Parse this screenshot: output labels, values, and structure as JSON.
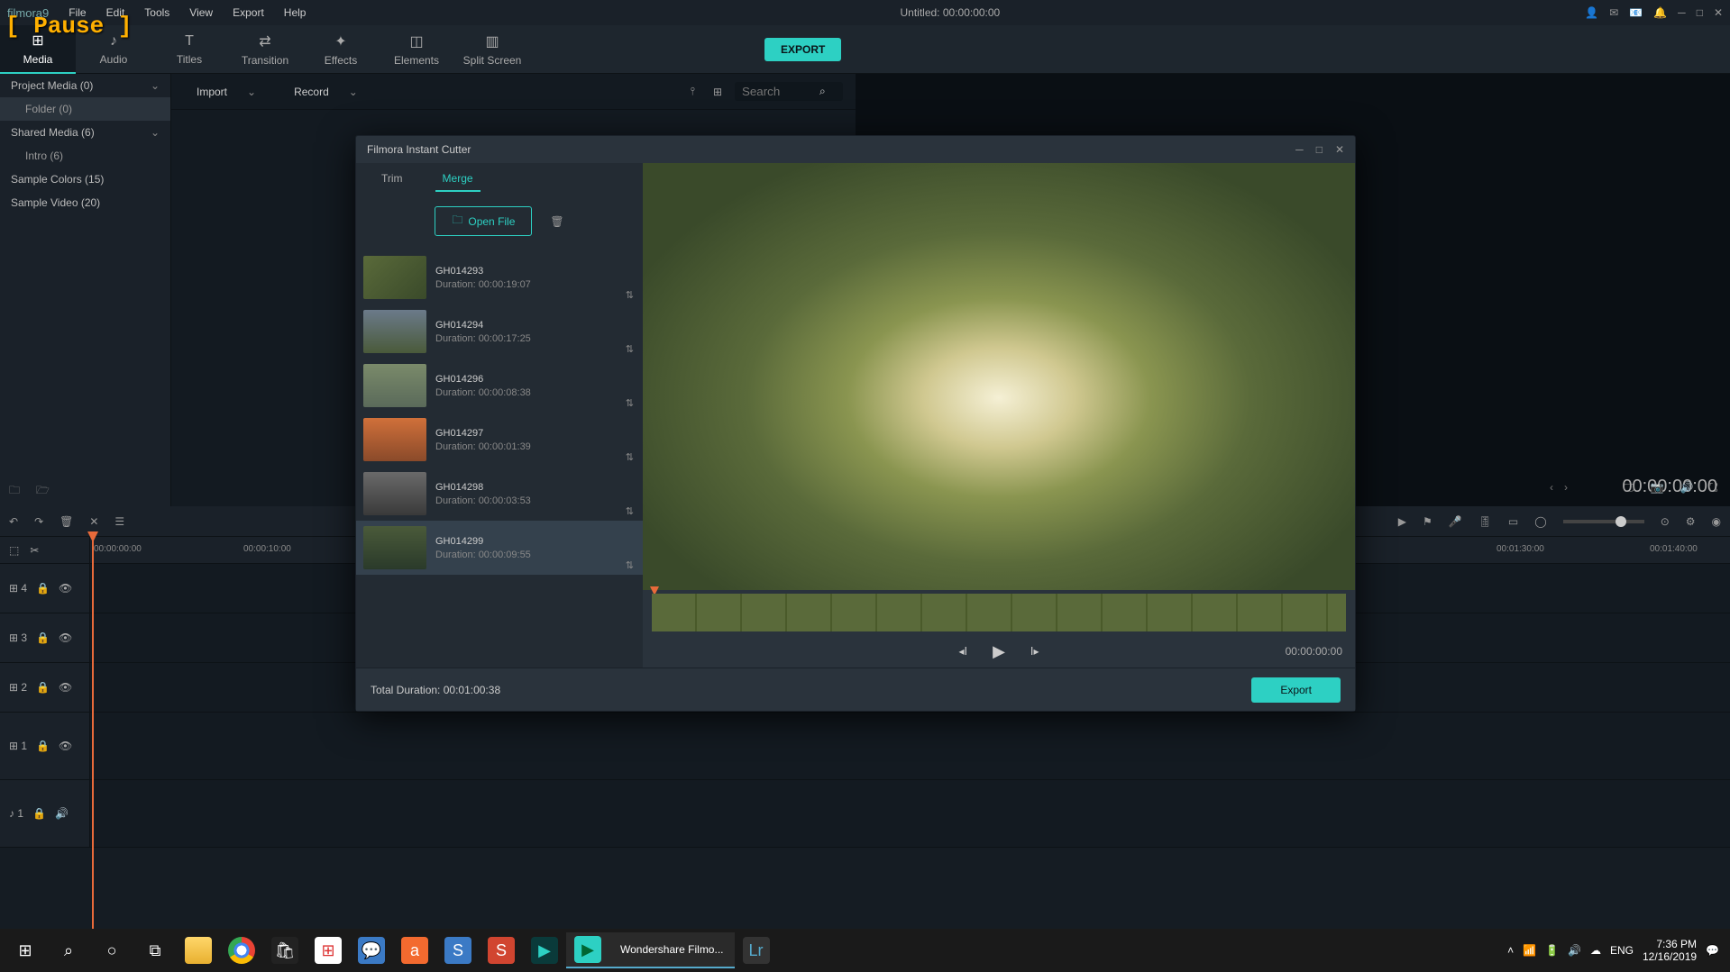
{
  "titlebar": {
    "logo": "filmora9",
    "menus": [
      "File",
      "Edit",
      "Tools",
      "View",
      "Export",
      "Help"
    ],
    "title": "Untitled:  00:00:00:00"
  },
  "pause_overlay": "[ Pause ]",
  "toolbar_tabs": [
    {
      "label": "Media",
      "icon": "⊞"
    },
    {
      "label": "Audio",
      "icon": "♪"
    },
    {
      "label": "Titles",
      "icon": "T"
    },
    {
      "label": "Transition",
      "icon": "⇄"
    },
    {
      "label": "Effects",
      "icon": "✦"
    },
    {
      "label": "Elements",
      "icon": "◫"
    },
    {
      "label": "Split Screen",
      "icon": "▥"
    }
  ],
  "export_label": "EXPORT",
  "sidebar": {
    "items": [
      {
        "label": "Project Media (0)",
        "expand": true
      },
      {
        "label": "Folder (0)",
        "sub": true,
        "hl": true
      },
      {
        "label": "Shared Media (6)",
        "expand": true
      },
      {
        "label": "Intro (6)",
        "sub": true
      },
      {
        "label": "Sample Colors (15)"
      },
      {
        "label": "Sample Video (20)"
      }
    ]
  },
  "media_bar": {
    "import": "Import",
    "record": "Record",
    "search_ph": "Search"
  },
  "preview": {
    "time": "00:00:00:00"
  },
  "timeline": {
    "ruler": [
      "00:00:00:00",
      "00:00:10:00",
      "00:01:30:00",
      "00:01:40:00"
    ],
    "ruler_pos": [
      0,
      170,
      1560,
      1730
    ],
    "tracks": [
      {
        "label": "⊞ 4"
      },
      {
        "label": "⊞ 3"
      },
      {
        "label": "⊞ 2"
      },
      {
        "label": "⊞ 1"
      },
      {
        "label": "♪ 1",
        "audio": true
      }
    ]
  },
  "modal": {
    "title": "Filmora Instant Cutter",
    "tabs": {
      "trim": "Trim",
      "merge": "Merge"
    },
    "open_file": "Open File",
    "clips": [
      {
        "name": "GH014293",
        "dur": "Duration: 00:00:19:07",
        "cls": ""
      },
      {
        "name": "GH014294",
        "dur": "Duration: 00:00:17:25",
        "cls": "t2"
      },
      {
        "name": "GH014296",
        "dur": "Duration: 00:00:08:38",
        "cls": "t3"
      },
      {
        "name": "GH014297",
        "dur": "Duration: 00:00:01:39",
        "cls": "t4"
      },
      {
        "name": "GH014298",
        "dur": "Duration: 00:00:03:53",
        "cls": "t5"
      },
      {
        "name": "GH014299",
        "dur": "Duration: 00:00:09:55",
        "cls": "t6",
        "sel": true
      }
    ],
    "playback_time": "00:00:00:00",
    "total_duration_label": "Total Duration:",
    "total_duration": "00:01:00:38",
    "export": "Export"
  },
  "taskbar": {
    "app_label": "Wondershare Filmo...",
    "lang": "ENG",
    "time": "7:36 PM",
    "date": "12/16/2019"
  }
}
